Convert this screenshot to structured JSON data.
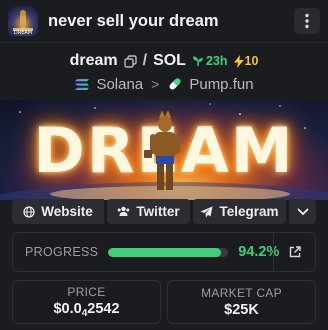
{
  "header": {
    "title": "never sell your dream",
    "thumb_icon": "token-avatar-icon",
    "menu_icon": "more-vertical-icon"
  },
  "pair": {
    "base": "dream",
    "separator": "/",
    "quote": "SOL",
    "age": "23h",
    "boosts": "10",
    "age_color": "#3fcf79",
    "boost_color": "#f4c430"
  },
  "chain": {
    "network": "Solana",
    "separator": ">",
    "dex": "Pump.fun"
  },
  "banner": {
    "text": "DREAM"
  },
  "links": {
    "website": "Website",
    "twitter": "Twitter",
    "telegram": "Telegram"
  },
  "progress": {
    "label": "PROGRESS",
    "value_text": "94.2%",
    "fraction": 0.942,
    "color": "#3fcf79"
  },
  "stats": {
    "price_label": "PRICE",
    "price_prefix": "$0.0",
    "price_zeros": "4",
    "price_digits": "2542",
    "mcap_label": "MARKET CAP",
    "mcap_value": "$25K"
  }
}
